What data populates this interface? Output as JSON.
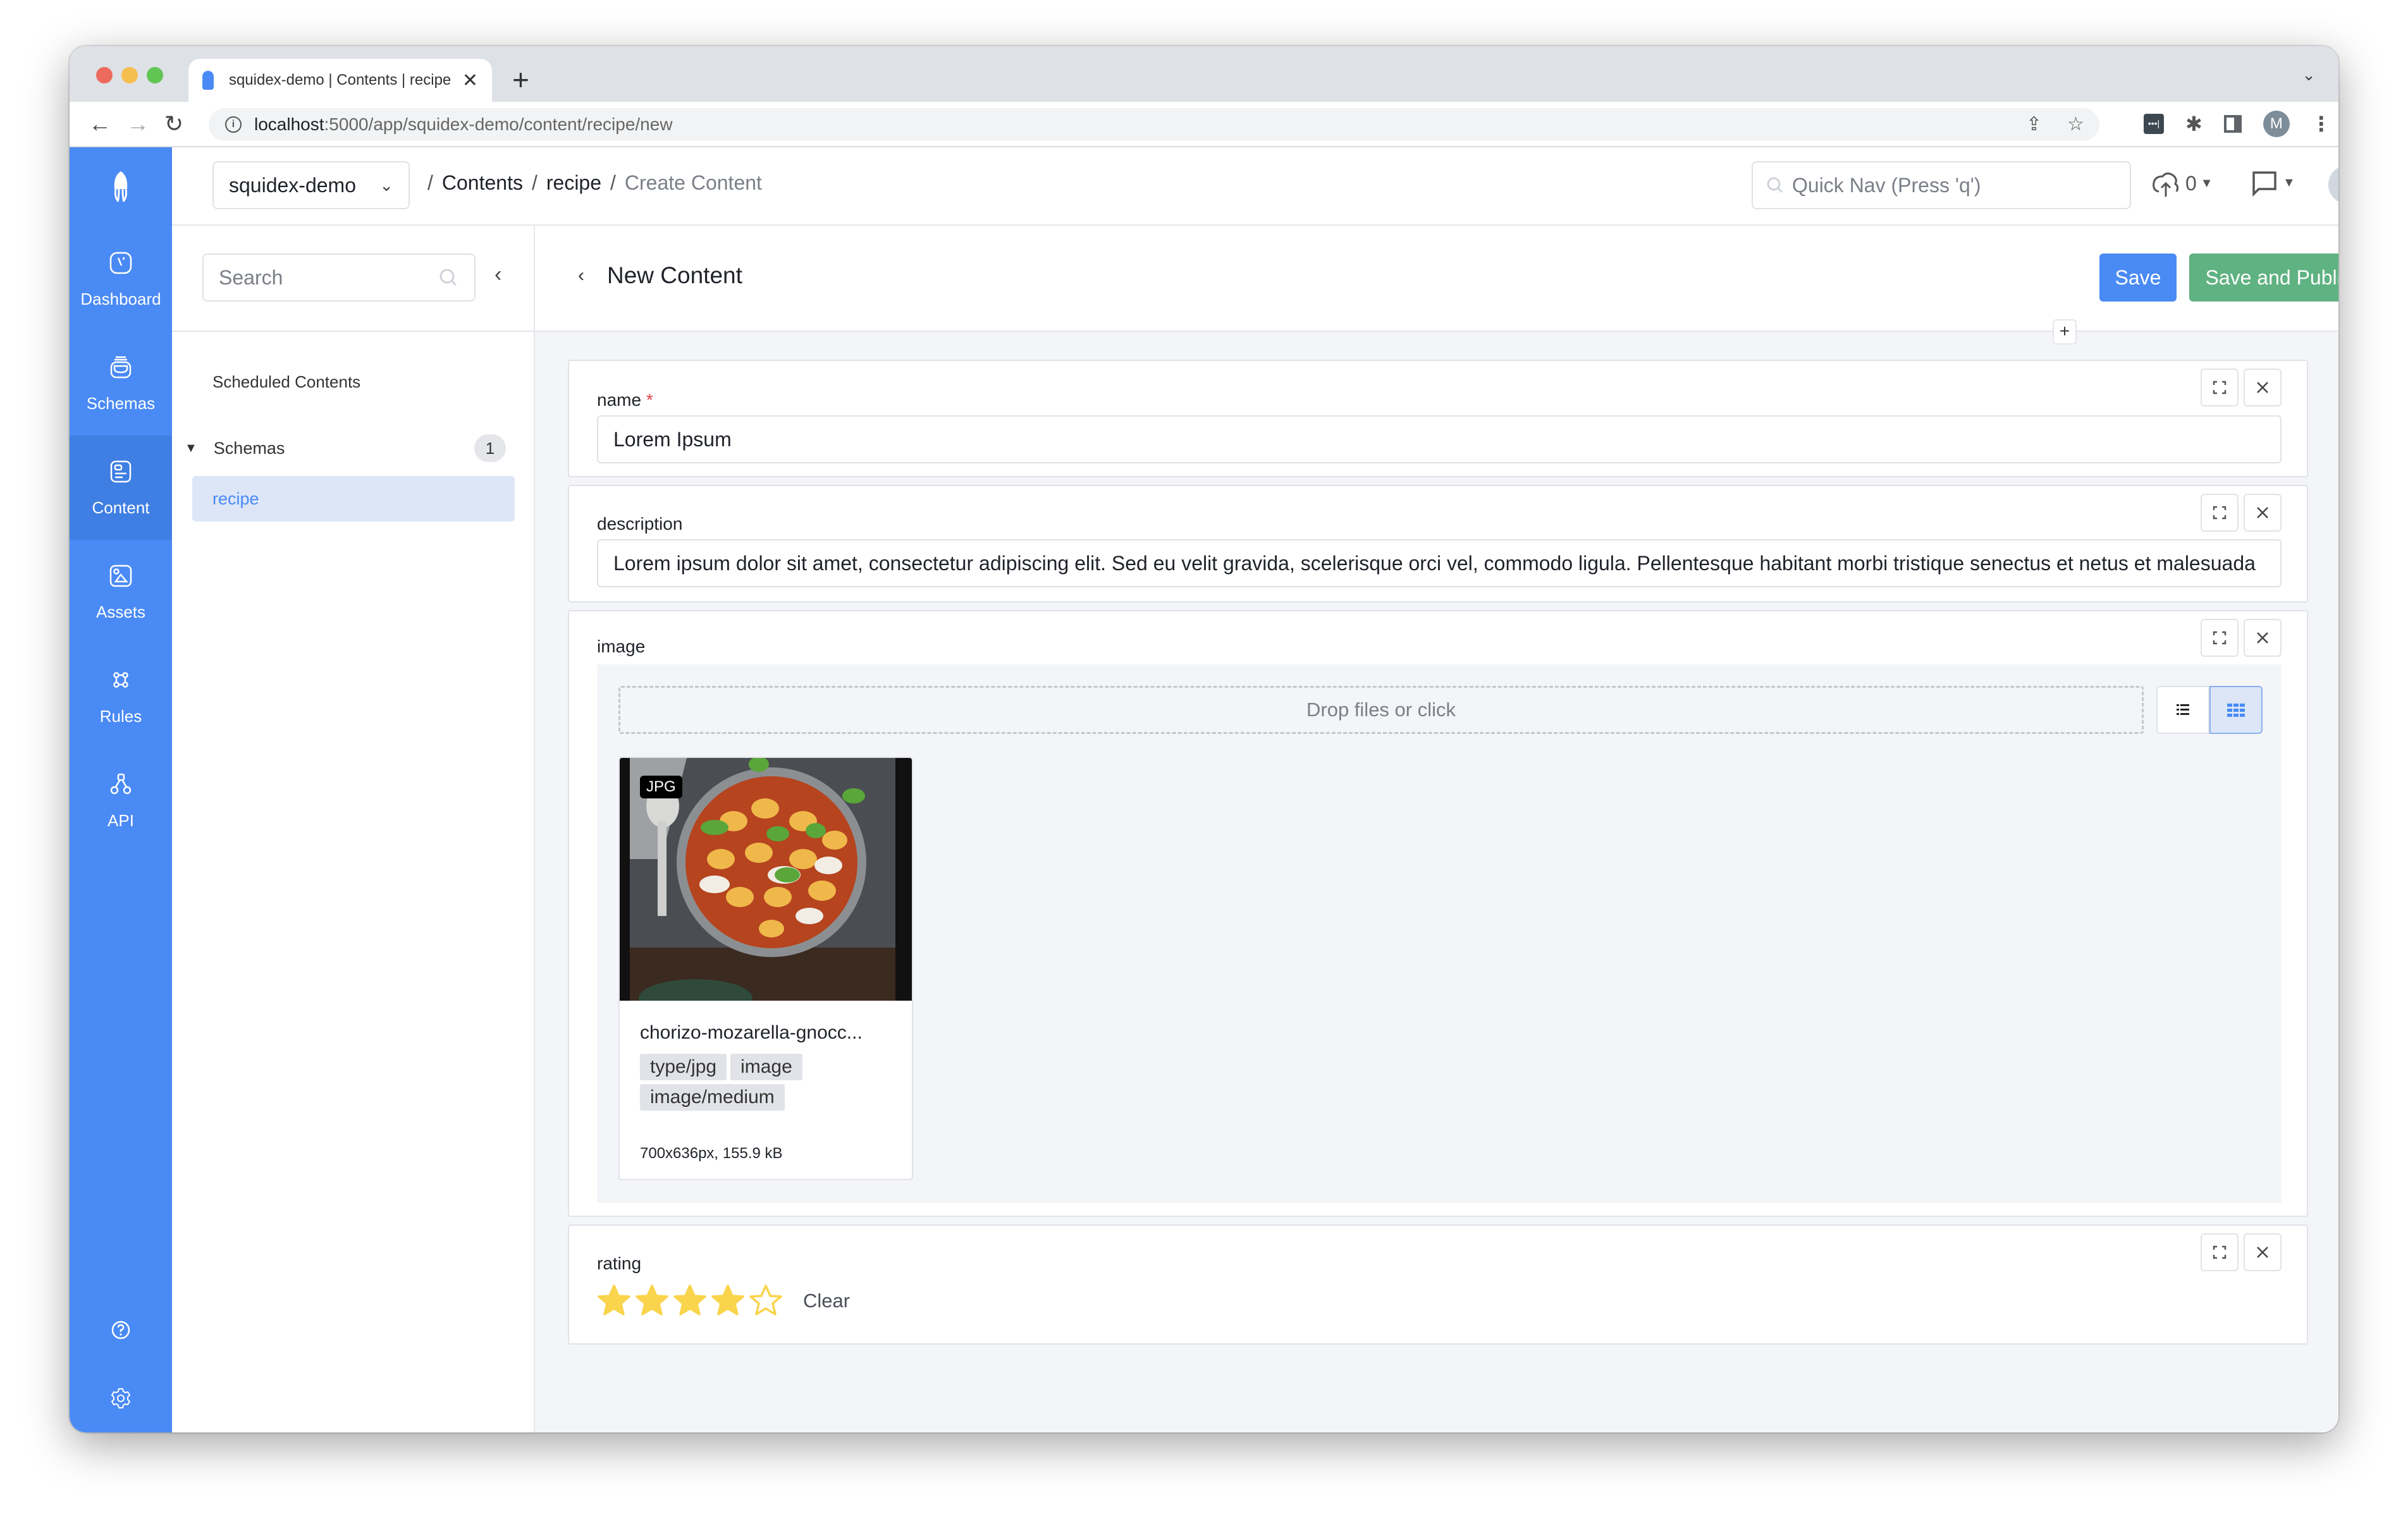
{
  "browser": {
    "tab_title": "squidex-demo | Contents | recipe",
    "tab_close": "✕",
    "new_tab": "+",
    "url_host": "localhost",
    "url_rest": ":5000/app/squidex-demo/content/recipe/new",
    "profile_initial": "M"
  },
  "header": {
    "app_name": "squidex-demo",
    "breadcrumb": [
      {
        "label": "Contents"
      },
      {
        "label": "recipe"
      },
      {
        "label": "Create Content"
      }
    ],
    "quick_nav_placeholder": "Quick Nav (Press 'q')",
    "upload_count": "0"
  },
  "leftnav": {
    "items": [
      {
        "label": "Dashboard",
        "icon": "dashboard-icon"
      },
      {
        "label": "Schemas",
        "icon": "schemas-icon"
      },
      {
        "label": "Content",
        "icon": "content-icon",
        "active": true
      },
      {
        "label": "Assets",
        "icon": "assets-icon"
      },
      {
        "label": "Rules",
        "icon": "rules-icon"
      },
      {
        "label": "API",
        "icon": "api-icon"
      }
    ]
  },
  "subnav": {
    "search_placeholder": "Search",
    "scheduled_label": "Scheduled Contents",
    "schemas_label": "Schemas",
    "schemas_count": "1",
    "schema_items": [
      {
        "label": "recipe",
        "selected": true
      }
    ]
  },
  "main": {
    "title": "New Content",
    "save_label": "Save",
    "publish_label": "Save and Publish",
    "add_field": "+",
    "fields": {
      "name": {
        "label": "name",
        "required_marker": "*",
        "value": "Lorem Ipsum"
      },
      "description": {
        "label": "description",
        "value": "Lorem ipsum dolor sit amet, consectetur adipiscing elit. Sed eu velit gravida, scelerisque orci vel, commodo ligula. Pellentesque habitant morbi tristique senectus et netus et malesuada"
      },
      "image": {
        "label": "image",
        "dropzone_text": "Drop files or click",
        "assets": [
          {
            "badge": "JPG",
            "name": "chorizo-mozarella-gnocc...",
            "tags": [
              "type/jpg",
              "image",
              "image/medium"
            ],
            "meta": "700x636px, 155.9 kB"
          }
        ]
      },
      "rating": {
        "label": "rating",
        "value": 4,
        "max": 5,
        "clear_label": "Clear"
      }
    }
  },
  "colors": {
    "primary": "#4a8af4",
    "success": "#5fb281",
    "star": "#f9d44c",
    "required": "#e0434b"
  }
}
